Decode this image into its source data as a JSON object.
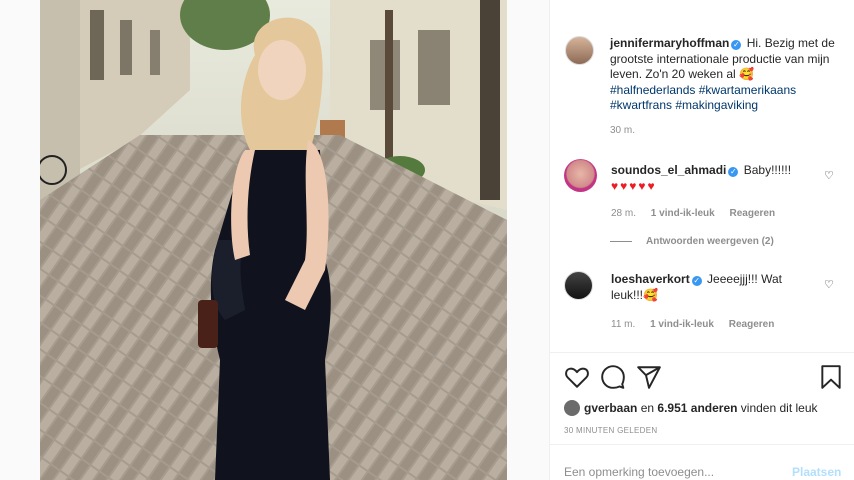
{
  "post": {
    "author": "jennifermaryhoffman",
    "caption_text": "Hi. Bezig met de grootste internationale productie van mijn leven. Zo'n 20 weken al 🥰",
    "hashtags": [
      "#halfnederlands",
      "#kwartamerikaans",
      "#kwartfrans",
      "#makingaviking"
    ],
    "time": "30 m."
  },
  "comments": [
    {
      "user": "soundos_el_ahmadi",
      "text": "Baby!!!!!!",
      "extra": "♥♥♥♥♥",
      "time": "28 m.",
      "likes": "1 vind-ik-leuk",
      "reply": "Reageren",
      "view_replies": "Antwoorden weergeven (2)"
    },
    {
      "user": "loeshaverkort",
      "text": "Jeeeejjj!!! Wat leuk!!!🥰",
      "time": "11 m.",
      "likes": "1 vind-ik-leuk",
      "reply": "Reageren"
    }
  ],
  "likes_line": {
    "user": "gverbaan",
    "middle": "en",
    "count": "6.951 anderen",
    "tail": "vinden dit leuk"
  },
  "posted_ago": "30 MINUTEN GELEDEN",
  "comment_input": {
    "placeholder": "Een opmerking toevoegen...",
    "post_label": "Plaatsen"
  },
  "icons": {
    "like": "heart-icon",
    "comment": "comment-icon",
    "share": "send-icon",
    "save": "bookmark-icon",
    "verified": "verified-badge"
  },
  "colors": {
    "link": "#00376b",
    "verified": "#3897f0",
    "hearts": "#ed1b24",
    "muted": "#8e8e8e",
    "post_button_disabled": "#b2dffc"
  }
}
